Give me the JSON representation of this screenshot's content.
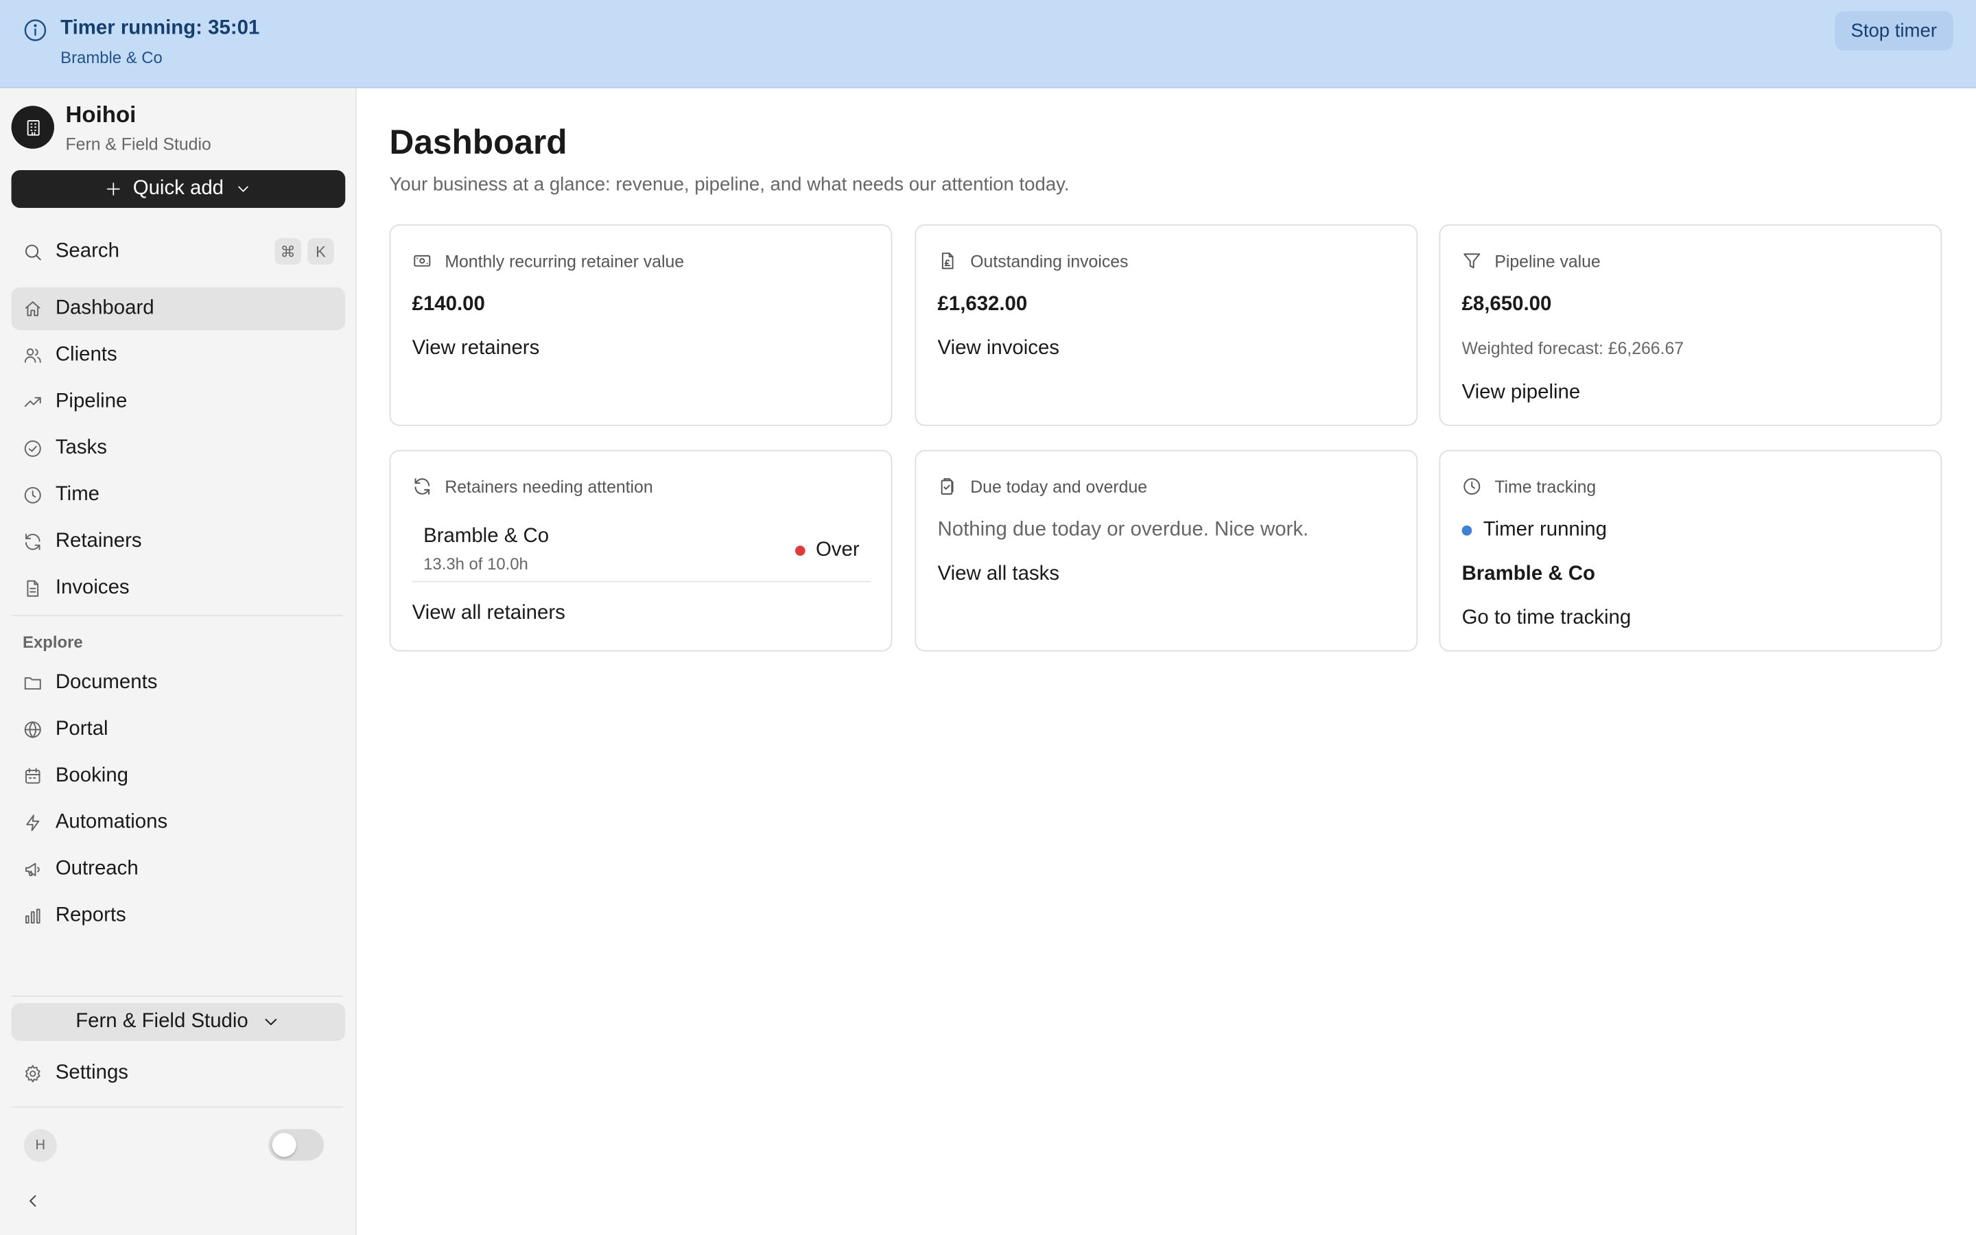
{
  "banner": {
    "title": "Timer running: 35:01",
    "subtitle": "Bramble & Co",
    "stop_label": "Stop timer",
    "icon": "info-icon"
  },
  "sidebar": {
    "brand_name": "Hoihoi",
    "brand_sub": "Fern & Field Studio",
    "quick_add_label": "Quick add",
    "search_label": "Search",
    "shortcut_keys": [
      "⌘",
      "K"
    ],
    "nav": [
      {
        "label": "Dashboard",
        "icon": "home-icon",
        "active": true
      },
      {
        "label": "Clients",
        "icon": "users-icon"
      },
      {
        "label": "Pipeline",
        "icon": "trending-up-icon"
      },
      {
        "label": "Tasks",
        "icon": "check-circle-icon"
      },
      {
        "label": "Time",
        "icon": "clock-icon"
      },
      {
        "label": "Retainers",
        "icon": "refresh-icon"
      },
      {
        "label": "Invoices",
        "icon": "file-icon"
      }
    ],
    "explore_label": "Explore",
    "explore": [
      {
        "label": "Documents",
        "icon": "folder-icon"
      },
      {
        "label": "Portal",
        "icon": "globe-icon"
      },
      {
        "label": "Booking",
        "icon": "calendar-icon"
      },
      {
        "label": "Automations",
        "icon": "zap-icon"
      },
      {
        "label": "Outreach",
        "icon": "megaphone-icon"
      },
      {
        "label": "Reports",
        "icon": "bar-chart-icon"
      }
    ],
    "workspace_label": "Fern & Field Studio",
    "settings_label": "Settings",
    "user_initial": "H"
  },
  "main": {
    "title": "Dashboard",
    "subtitle": "Your business at a glance: revenue, pipeline, and what needs our attention today.",
    "cards": {
      "retainer_value": {
        "caption": "Monthly recurring retainer value",
        "value": "£140.00",
        "link": "View retainers"
      },
      "outstanding": {
        "caption": "Outstanding invoices",
        "value": "£1,632.00",
        "link": "View invoices"
      },
      "pipeline": {
        "caption": "Pipeline value",
        "value": "£8,650.00",
        "meta": "Weighted forecast: £6,266.67",
        "link": "View pipeline"
      },
      "retainers_attention": {
        "caption": "Retainers needing attention",
        "row": {
          "name": "Bramble & Co",
          "meta": "13.3h of 10.0h",
          "status": "Over",
          "status_color": "#e0393e"
        },
        "link": "View all retainers"
      },
      "due": {
        "caption": "Due today and overdue",
        "empty": "Nothing due today or overdue. Nice work.",
        "link": "View all tasks"
      },
      "time": {
        "caption": "Time tracking",
        "status": "Timer running",
        "status_color": "#3f7fd6",
        "client": "Bramble & Co",
        "link": "Go to time tracking"
      }
    }
  },
  "colors": {
    "banner_bg": "#c5dcf7",
    "banner_text": "#163f70",
    "sidebar_bg": "#f4f4f4",
    "primary_button": "#222222"
  }
}
